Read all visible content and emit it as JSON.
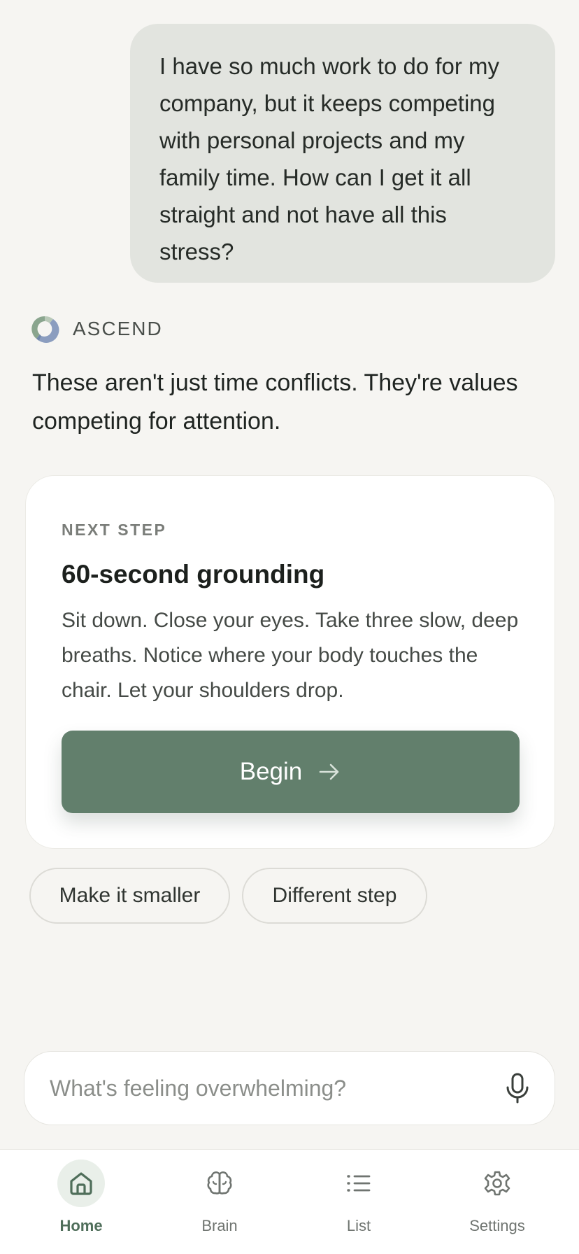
{
  "conversation": {
    "user_message": "I have so much work to do for my company, but it keeps competing with personal projects and my family time. How can I get it all straight and not have all this stress?",
    "assistant": {
      "name": "ASCEND",
      "logo_icon": "ascend-logo-icon",
      "message": "These aren't just time conflicts. They're values competing for attention."
    }
  },
  "next_step_card": {
    "label": "NEXT STEP",
    "title": "60-second grounding",
    "description": "Sit down. Close your eyes. Take three slow, deep breaths. Notice where your body touches the chair. Let your shoulders drop.",
    "button_label": "Begin",
    "button_icon": "arrow-right-icon"
  },
  "suggestions": [
    {
      "label": "Make it smaller"
    },
    {
      "label": "Different step"
    }
  ],
  "input": {
    "placeholder": "What's feeling overwhelming?",
    "value": "",
    "mic_icon": "microphone-icon"
  },
  "nav": {
    "items": [
      {
        "label": "Home",
        "icon": "home-icon",
        "active": true
      },
      {
        "label": "Brain",
        "icon": "brain-icon",
        "active": false
      },
      {
        "label": "List",
        "icon": "list-icon",
        "active": false
      },
      {
        "label": "Settings",
        "icon": "gear-icon",
        "active": false
      }
    ]
  },
  "colors": {
    "background": "#f6f5f2",
    "user_bubble": "#e2e4df",
    "accent_green": "#627f6c",
    "nav_active": "#4f6e5a",
    "nav_active_bg": "#e9efe9"
  }
}
